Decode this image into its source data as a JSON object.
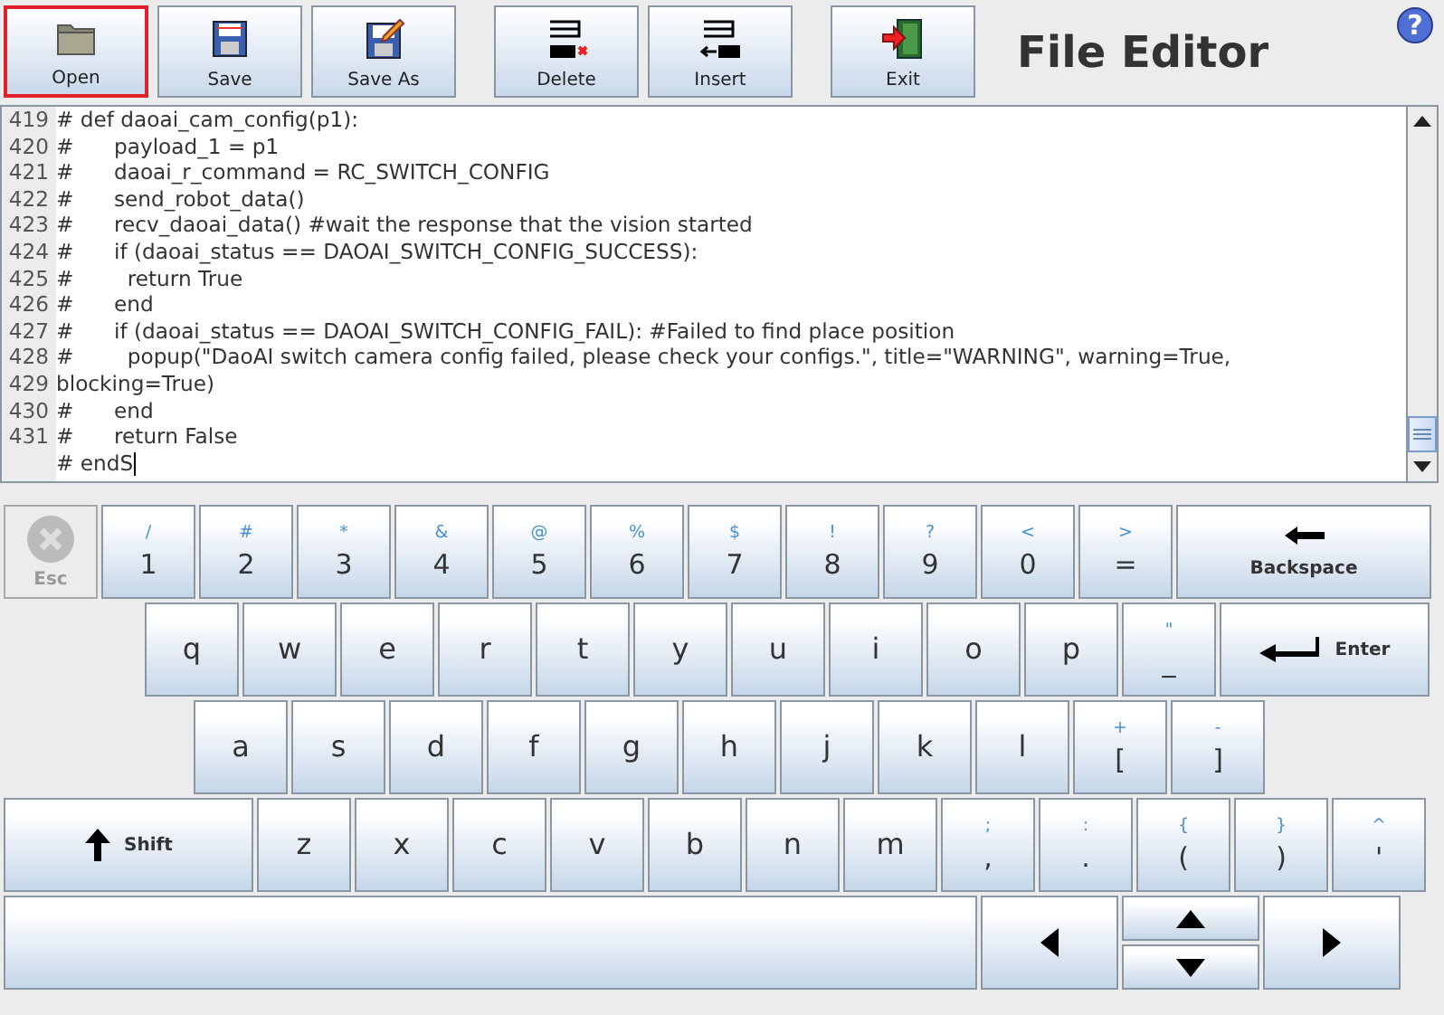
{
  "toolbar": {
    "buttons": [
      {
        "kind": "open",
        "label": "Open",
        "selected": true
      },
      {
        "kind": "save",
        "label": "Save",
        "selected": false
      },
      {
        "kind": "saveas",
        "label": "Save As",
        "selected": false
      },
      {
        "kind": "delete",
        "label": "Delete",
        "selected": false
      },
      {
        "kind": "insert",
        "label": "Insert",
        "selected": false
      },
      {
        "kind": "exit",
        "label": "Exit",
        "selected": false
      }
    ],
    "title": "File Editor",
    "help": "?"
  },
  "editor": {
    "lines": [
      {
        "number": "419",
        "text": "# def daoai_cam_config(p1):"
      },
      {
        "number": "420",
        "text": "#\tpayload_1 = p1"
      },
      {
        "number": "421",
        "text": "#\tdaoai_r_command = RC_SWITCH_CONFIG"
      },
      {
        "number": "422",
        "text": "#\tsend_robot_data()"
      },
      {
        "number": "423",
        "text": "#\trecv_daoai_data() #wait the response that the vision started"
      },
      {
        "number": "424",
        "text": "#\tif (daoai_status == DAOAI_SWITCH_CONFIG_SUCCESS):"
      },
      {
        "number": "425",
        "text": "#\t  return True"
      },
      {
        "number": "426",
        "text": "#\tend"
      },
      {
        "number": "427",
        "text": "#\tif (daoai_status == DAOAI_SWITCH_CONFIG_FAIL): #Failed to find place position"
      },
      {
        "number": "428",
        "text": "#\t  popup(\"DaoAI switch camera config failed, please check your configs.\", title=\"WARNING\", warning=True,"
      },
      {
        "number": "429",
        "text": "blocking=True)"
      },
      {
        "number": "430",
        "text": "#\tend"
      },
      {
        "number": "431",
        "text": "#\treturn False"
      },
      {
        "text": "# endS",
        "caret": true
      }
    ]
  },
  "keyboard": {
    "rows": [
      {
        "keys": [
          {
            "kind": "esc",
            "label": "Esc",
            "disabled": true
          },
          {
            "kind": "dual",
            "top": "/",
            "main": "1"
          },
          {
            "kind": "dual",
            "top": "#",
            "main": "2"
          },
          {
            "kind": "dual",
            "top": "*",
            "main": "3"
          },
          {
            "kind": "dual",
            "top": "&",
            "main": "4"
          },
          {
            "kind": "dual",
            "top": "@",
            "main": "5"
          },
          {
            "kind": "dual",
            "top": "%",
            "main": "6"
          },
          {
            "kind": "dual",
            "top": "$",
            "main": "7"
          },
          {
            "kind": "dual",
            "top": "!",
            "main": "8"
          },
          {
            "kind": "dual",
            "top": "?",
            "main": "9"
          },
          {
            "kind": "dual",
            "top": "<",
            "main": "0"
          },
          {
            "kind": "dual",
            "top": ">",
            "main": "="
          },
          {
            "kind": "backspace",
            "label": "Backspace"
          }
        ]
      },
      {
        "keys": [
          {
            "kind": "letter",
            "main": "q"
          },
          {
            "kind": "letter",
            "main": "w"
          },
          {
            "kind": "letter",
            "main": "e"
          },
          {
            "kind": "letter",
            "main": "r"
          },
          {
            "kind": "letter",
            "main": "t"
          },
          {
            "kind": "letter",
            "main": "y"
          },
          {
            "kind": "letter",
            "main": "u"
          },
          {
            "kind": "letter",
            "main": "i"
          },
          {
            "kind": "letter",
            "main": "o"
          },
          {
            "kind": "letter",
            "main": "p"
          },
          {
            "kind": "dual",
            "top": "\"",
            "main": "_"
          },
          {
            "kind": "enter",
            "label": "Enter"
          }
        ]
      },
      {
        "keys": [
          {
            "kind": "letter",
            "main": "a"
          },
          {
            "kind": "letter",
            "main": "s"
          },
          {
            "kind": "letter",
            "main": "d"
          },
          {
            "kind": "letter",
            "main": "f"
          },
          {
            "kind": "letter",
            "main": "g"
          },
          {
            "kind": "letter",
            "main": "h"
          },
          {
            "kind": "letter",
            "main": "j"
          },
          {
            "kind": "letter",
            "main": "k"
          },
          {
            "kind": "letter",
            "main": "l"
          },
          {
            "kind": "dual",
            "top": "+",
            "main": "["
          },
          {
            "kind": "dual",
            "top": "-",
            "main": "]"
          }
        ]
      },
      {
        "keys": [
          {
            "kind": "shift",
            "label": "Shift"
          },
          {
            "kind": "letter",
            "main": "z"
          },
          {
            "kind": "letter",
            "main": "x"
          },
          {
            "kind": "letter",
            "main": "c"
          },
          {
            "kind": "letter",
            "main": "v"
          },
          {
            "kind": "letter",
            "main": "b"
          },
          {
            "kind": "letter",
            "main": "n"
          },
          {
            "kind": "letter",
            "main": "m"
          },
          {
            "kind": "dual",
            "top": ";",
            "main": ","
          },
          {
            "kind": "dual",
            "top": ":",
            "main": "."
          },
          {
            "kind": "dual",
            "top": "{",
            "main": "("
          },
          {
            "kind": "dual",
            "top": "}",
            "main": ")"
          },
          {
            "kind": "dual",
            "top": "^",
            "main": "'"
          }
        ]
      },
      {
        "keys": [
          {
            "kind": "space"
          },
          {
            "kind": "left"
          },
          {
            "kind": "updown"
          },
          {
            "kind": "right"
          }
        ]
      }
    ]
  }
}
